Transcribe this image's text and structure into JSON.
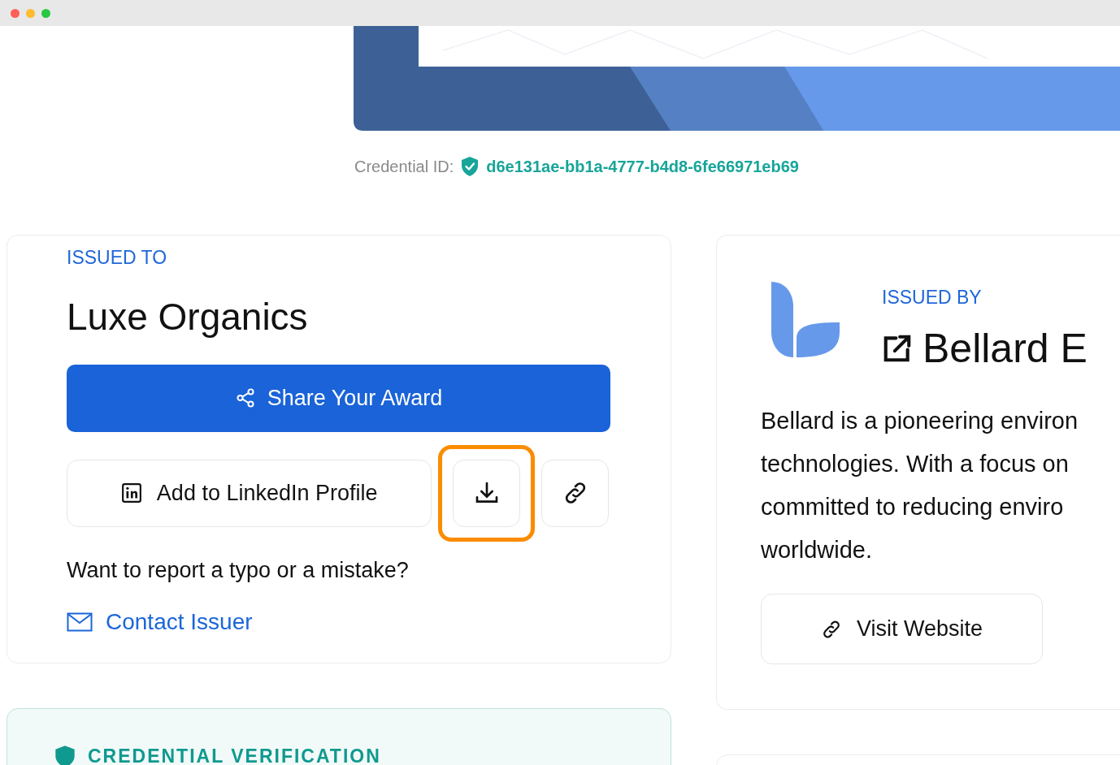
{
  "credential": {
    "label": "Credential ID:",
    "id": "d6e131ae-bb1a-4777-b4d8-6fe66971eb69"
  },
  "issued_to": {
    "label": "ISSUED TO",
    "name": "Luxe Organics",
    "share_button": "Share Your Award",
    "linkedin_button": "Add to LinkedIn Profile",
    "download_highlighted": true,
    "report_text": "Want to report a typo or a mistake?",
    "contact_link": "Contact Issuer"
  },
  "issued_by": {
    "label": "ISSUED BY",
    "name": "Bellard E",
    "description_lines": [
      "Bellard is a pioneering environ",
      "technologies. With a focus on",
      "committed to reducing enviro",
      "worldwide."
    ],
    "website_button": "Visit Website"
  },
  "verification": {
    "title": "CREDENTIAL VERIFICATION"
  }
}
